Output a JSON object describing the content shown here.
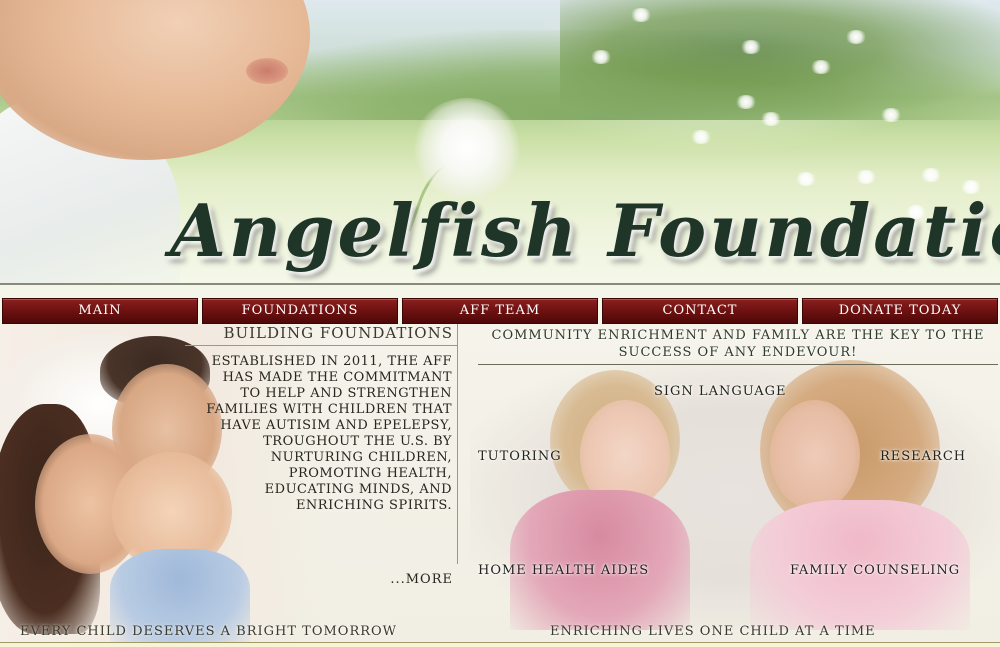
{
  "header": {
    "site_title": "Angelfish Foundation"
  },
  "nav": {
    "items": [
      {
        "label": "MAIN"
      },
      {
        "label": "FOUNDATIONS"
      },
      {
        "label": "AFF TEAM"
      },
      {
        "label": "CONTACT"
      },
      {
        "label": "DONATE TODAY"
      }
    ]
  },
  "building_foundations": {
    "heading": "BUILDING FOUNDATIONS",
    "text": "ESTABLISHED IN 2011, THE AFF HAS MADE THE COMMITMANT TO HELP AND STRENGTHEN FAMILIES WITH CHILDREN THAT HAVE AUTISIM AND EPELEPSY, TROUGHOUT THE U.S. BY NURTURING CHILDREN, PROMOTING HEALTH, EDUCATING MINDS, AND ENRICHING SPIRITS.",
    "more_link": "...MORE"
  },
  "community": {
    "heading": "COMMUNITY ENRICHMENT AND FAMILY ARE THE KEY TO THE SUCCESS OF ANY ENDEVOUR!",
    "services": {
      "sign_language": "SIGN LANGUAGE",
      "tutoring": "TUTORING",
      "research": "RESEARCH",
      "home_health_aides": "HOME HEALTH AIDES",
      "family_counseling": "FAMILY COUNSELING"
    }
  },
  "footer": {
    "tagline_left": "EVERY CHILD DESERVES A BRIGHT TOMORROW",
    "tagline_right": "ENRICHING LIVES ONE CHILD AT A TIME"
  },
  "colors": {
    "nav_background": "#6d1111",
    "title_color": "#1e3528",
    "background": "#f4f6ea"
  }
}
